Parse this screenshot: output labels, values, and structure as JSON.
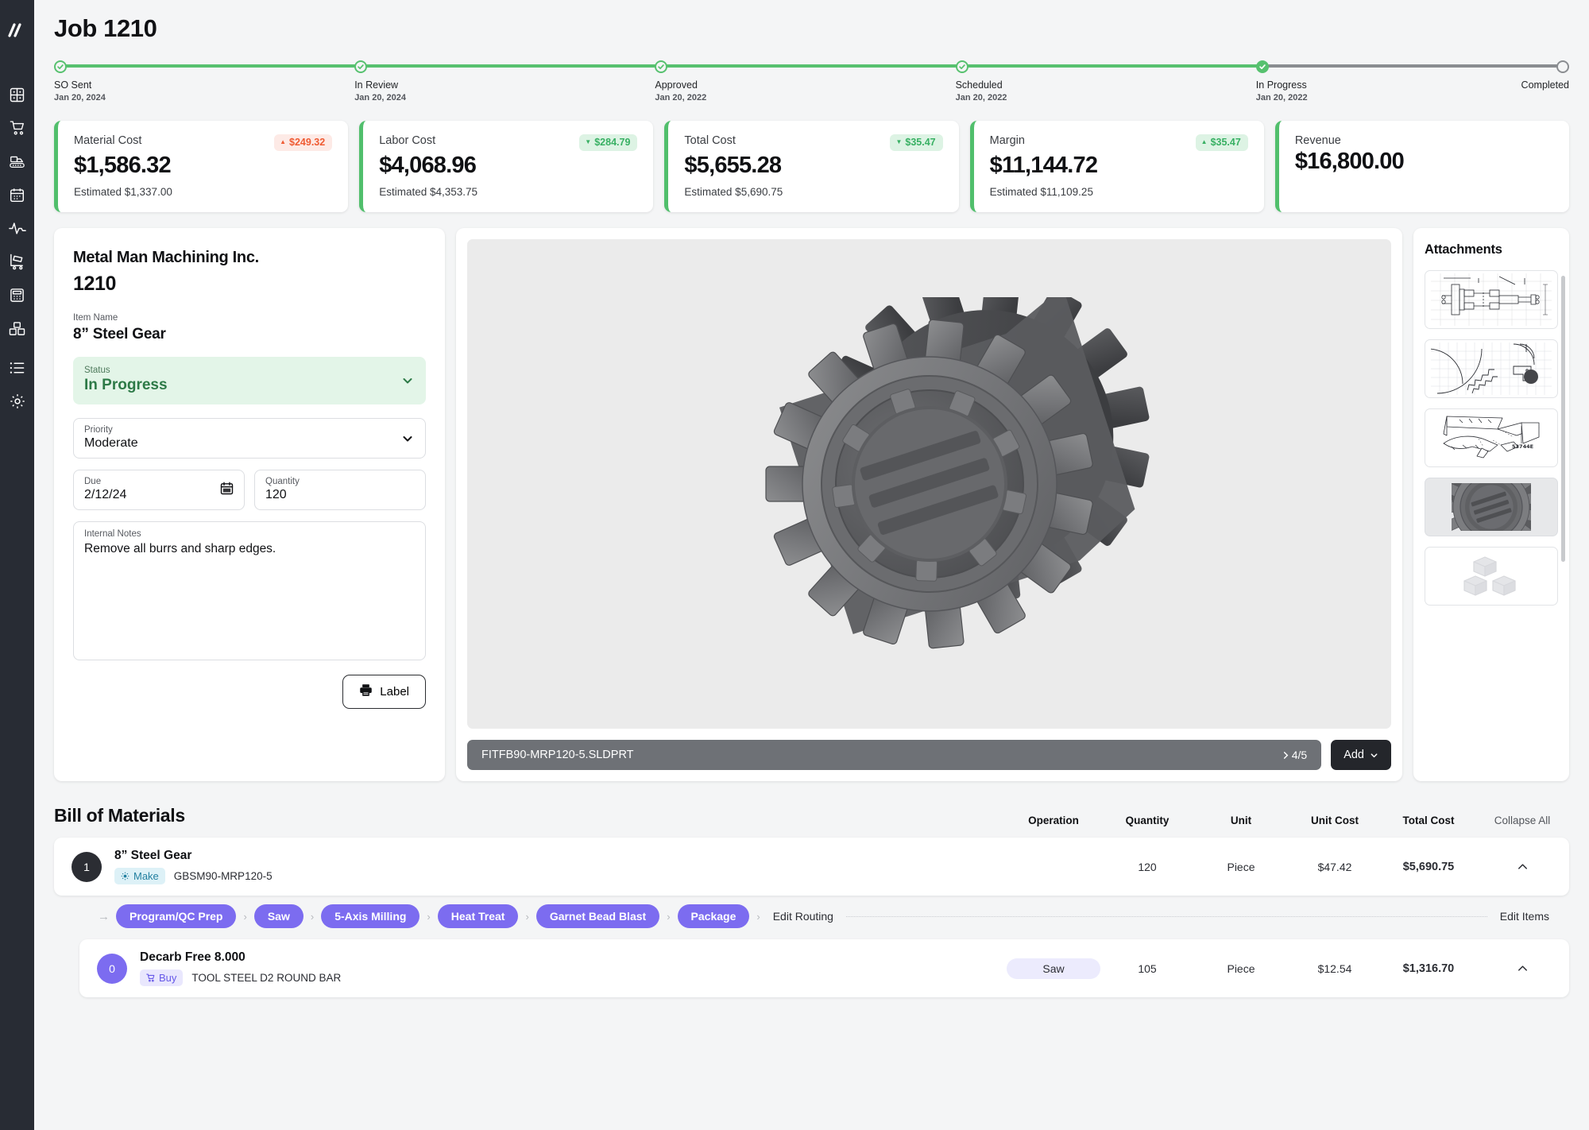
{
  "sidebar": {
    "logo": "slash-logo",
    "items": [
      {
        "icon": "dashboard-grid-icon",
        "name": "dashboard"
      },
      {
        "icon": "shopping-cart-icon",
        "name": "orders"
      },
      {
        "icon": "conveyor-belt-icon",
        "name": "production"
      },
      {
        "icon": "calendar-icon",
        "name": "schedule"
      },
      {
        "icon": "activity-pulse-icon",
        "name": "analytics"
      },
      {
        "icon": "hand-truck-icon",
        "name": "shipping"
      },
      {
        "icon": "calculator-icon",
        "name": "quoting"
      },
      {
        "icon": "boxes-icon",
        "name": "inventory"
      },
      {
        "icon": "list-icon",
        "name": "lists"
      },
      {
        "icon": "gear-icon",
        "name": "settings"
      }
    ]
  },
  "header": {
    "title": "Job 1210"
  },
  "stepper": {
    "steps": [
      {
        "label": "SO Sent",
        "date": "Jan 20, 2024",
        "state": "complete"
      },
      {
        "label": "In Review",
        "date": "Jan 20, 2024",
        "state": "complete"
      },
      {
        "label": "Approved",
        "date": "Jan 20, 2022",
        "state": "complete"
      },
      {
        "label": "Scheduled",
        "date": "Jan 20, 2022",
        "state": "complete"
      },
      {
        "label": "In Progress",
        "date": "Jan 20, 2022",
        "state": "current"
      },
      {
        "label": "Completed",
        "date": "",
        "state": "pending"
      }
    ],
    "fill_color": "#57c16f",
    "track_color": "#8a8d91"
  },
  "kpis": [
    {
      "label": "Material Cost",
      "value": "$1,586.32",
      "badge": "$249.32",
      "direction": "up",
      "estimate": "Estimated $1,337.00"
    },
    {
      "label": "Labor Cost",
      "value": "$4,068.96",
      "badge": "$284.79",
      "direction": "down",
      "estimate": "Estimated $4,353.75"
    },
    {
      "label": "Total Cost",
      "value": "$5,655.28",
      "badge": "$35.47",
      "direction": "down",
      "estimate": "Estimated $5,690.75"
    },
    {
      "label": "Margin",
      "value": "$11,144.72",
      "badge": "$35.47",
      "direction": "up-green",
      "estimate": "Estimated $11,109.25"
    },
    {
      "label": "Revenue",
      "value": "$16,800.00",
      "badge": "",
      "direction": "",
      "estimate": ""
    }
  ],
  "detail": {
    "company": "Metal Man Machining Inc.",
    "job_number": "1210",
    "item_name_label": "Item Name",
    "item_name": "8” Steel Gear",
    "status_label": "Status",
    "status_value": "In Progress",
    "priority_label": "Priority",
    "priority_value": "Moderate",
    "due_label": "Due",
    "due_value": "2/12/24",
    "quantity_label": "Quantity",
    "quantity_value": "120",
    "notes_label": "Internal Notes",
    "notes_value": "Remove all burrs and sharp edges.",
    "label_button": "Label"
  },
  "viewer": {
    "file_name": "FITFB90-MRP120-5.SLDPRT",
    "counter": "4/5",
    "add_button": "Add",
    "model": "3d-gear-model"
  },
  "attachments": {
    "title": "Attachments",
    "items": [
      {
        "name": "assembly-drawing-thumbnail",
        "selected": false
      },
      {
        "name": "gear-profile-drawing-thumbnail",
        "selected": false
      },
      {
        "name": "frame-exploded-drawing-thumbnail",
        "selected": false
      },
      {
        "name": "gear-3d-render-thumbnail",
        "selected": true
      },
      {
        "name": "add-attachment-placeholder",
        "selected": false
      }
    ]
  },
  "bom": {
    "title": "Bill of Materials",
    "columns": [
      "Operation",
      "Quantity",
      "Unit",
      "Unit Cost",
      "Total Cost"
    ],
    "collapse_all": "Collapse All",
    "rows": [
      {
        "index": "1",
        "index_style": "dark",
        "name": "8” Steel Gear",
        "tag": "Make",
        "tag_style": "make",
        "code": "GBSM90-MRP120-5",
        "operation": "",
        "quantity": "120",
        "unit": "Piece",
        "unit_cost": "$47.42",
        "total_cost": "$5,690.75"
      },
      {
        "index": "0",
        "index_style": "purple",
        "name": "Decarb Free 8.000",
        "tag": "Buy",
        "tag_style": "buy",
        "code": "TOOL STEEL D2 ROUND BAR",
        "operation": "Saw",
        "quantity": "105",
        "unit": "Piece",
        "unit_cost": "$12.54",
        "total_cost": "$1,316.70"
      }
    ],
    "routing": {
      "operations": [
        "Program/QC Prep",
        "Saw",
        "5-Axis Milling",
        "Heat Treat",
        "Garnet Bead Blast",
        "Package"
      ],
      "edit_routing": "Edit Routing",
      "edit_items": "Edit Items"
    }
  },
  "colors": {
    "accent_green": "#57c16f",
    "accent_purple": "#7c6cf0",
    "sidebar_bg": "#282c34",
    "page_bg": "#f4f5f6",
    "up_red": "#ef5b33",
    "down_green": "#38b063"
  }
}
